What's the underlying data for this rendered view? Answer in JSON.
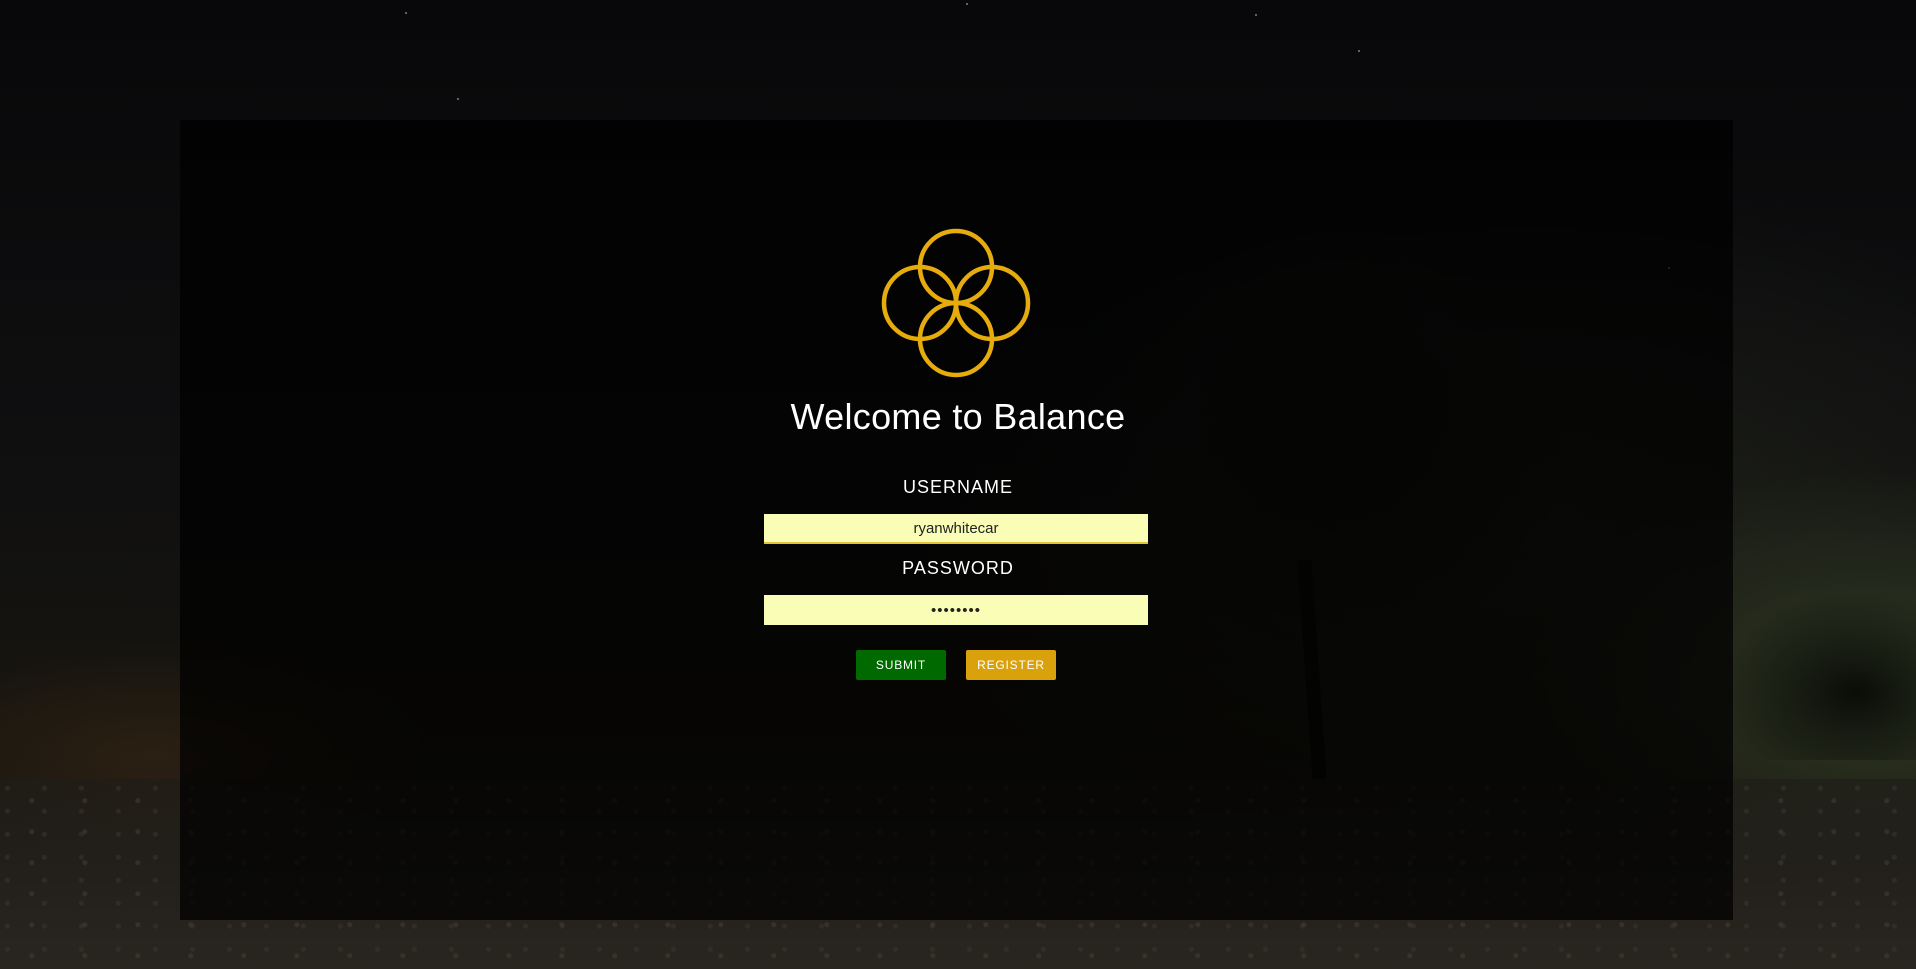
{
  "app": {
    "title": "Welcome to Balance"
  },
  "logo": {
    "icon": "overlapping-rings-logo-icon",
    "color": "#e6ac0c"
  },
  "form": {
    "username_label": "USERNAME",
    "username_value": "ryanwhitecar",
    "password_label": "PASSWORD",
    "password_value": "••••••••",
    "input_background": "#fafdb5"
  },
  "buttons": {
    "submit_label": "SUBMIT",
    "submit_color": "#006a00",
    "register_label": "REGISTER",
    "register_color": "#d9a10c"
  }
}
